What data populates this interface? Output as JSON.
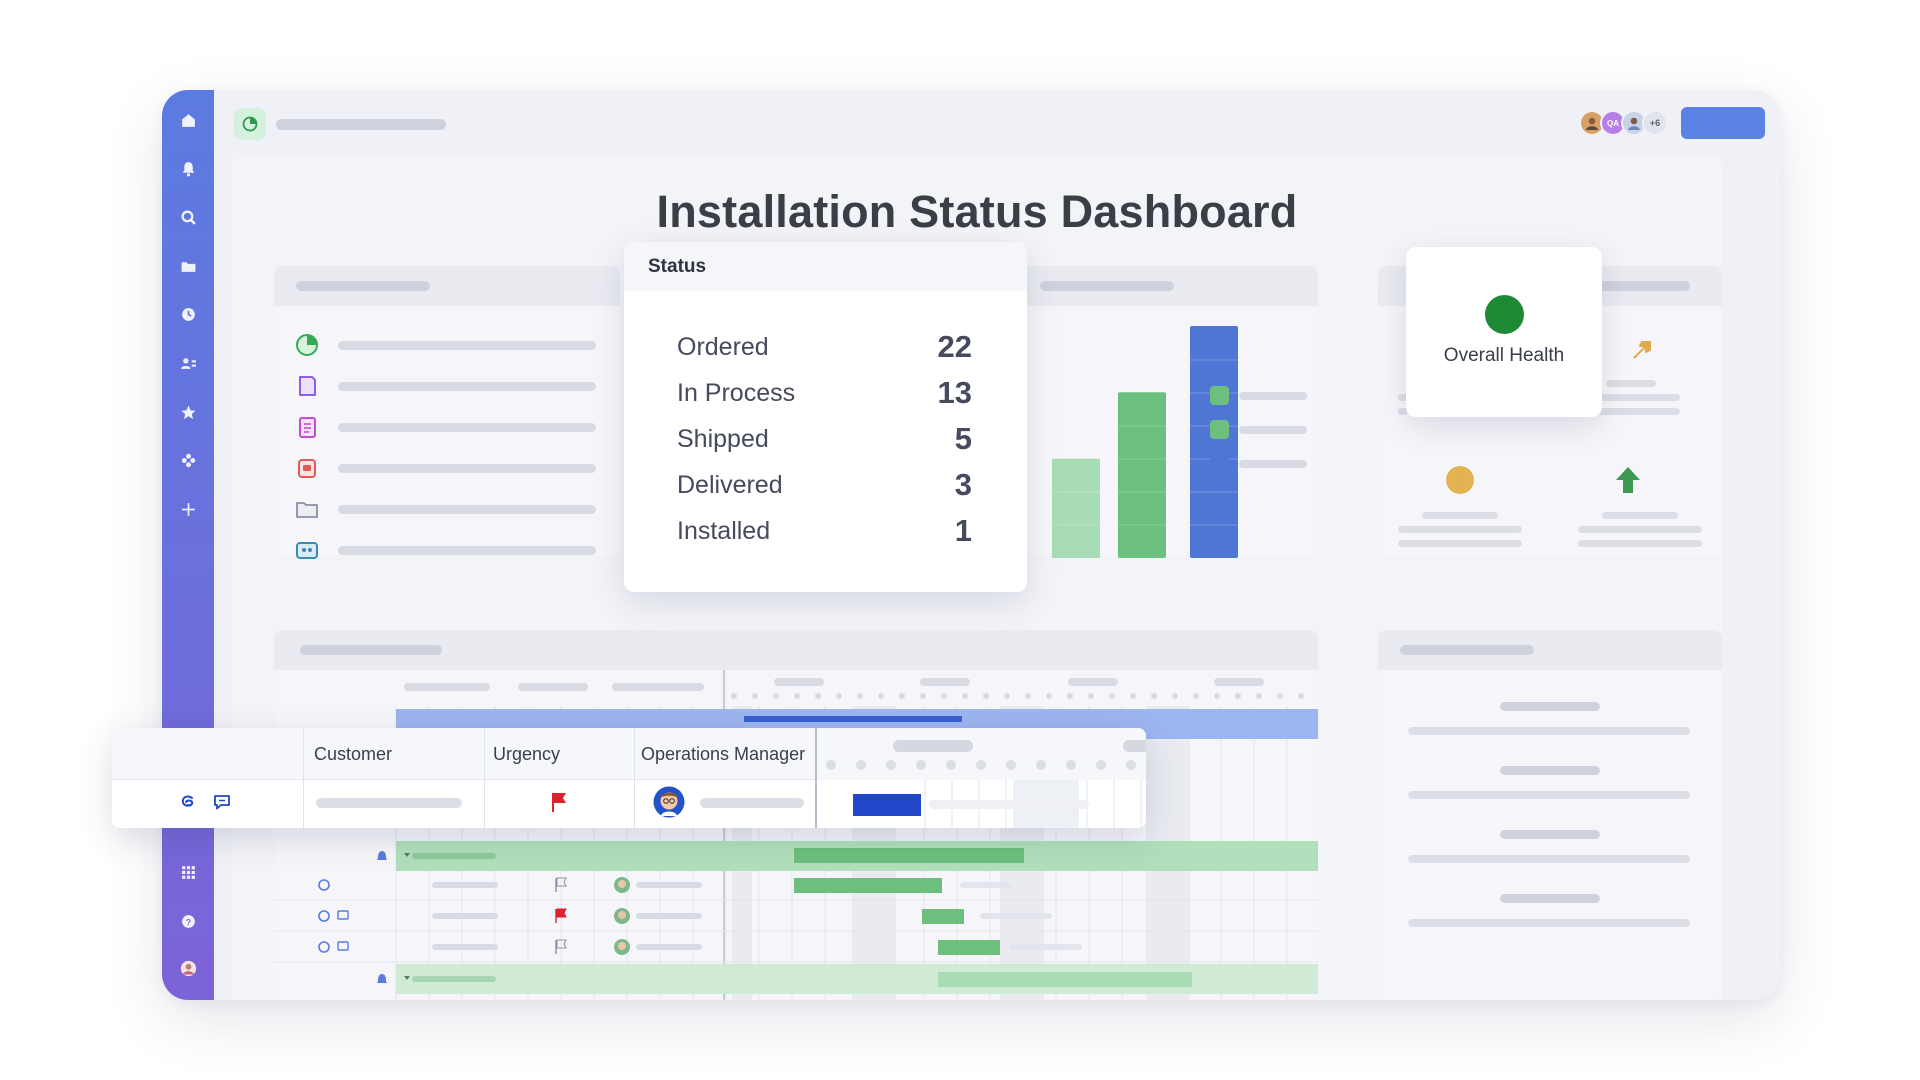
{
  "dashboard": {
    "title": "Installation Status Dashboard"
  },
  "topbar": {
    "avatars": [
      "QA",
      "+6"
    ]
  },
  "status_widget": {
    "heading": "Status",
    "rows": [
      {
        "label": "Ordered",
        "value": "22"
      },
      {
        "label": "In Process",
        "value": "13"
      },
      {
        "label": "Shipped",
        "value": "5"
      },
      {
        "label": "Delivered",
        "value": "3"
      },
      {
        "label": "Installed",
        "value": "1"
      }
    ]
  },
  "health_widget": {
    "label": "Overall Health",
    "color": "#1f8a35"
  },
  "chart_data": {
    "type": "bar",
    "categories": [
      "",
      "",
      ""
    ],
    "values": [
      15,
      25,
      35
    ],
    "colors": [
      "#a8dcb4",
      "#6cbf7d",
      "#4f76d4"
    ]
  },
  "table": {
    "columns": [
      "Customer",
      "Urgency",
      "Operations Manager"
    ]
  },
  "colors": {
    "sidebar_top": "#5b7be0",
    "sidebar_bottom": "#7d63d8",
    "primary_button": "#5d82e6",
    "gantt_blue": "#1f47c8",
    "gantt_green": "#6cbf7d",
    "urgency_flag": "#d9232e"
  }
}
